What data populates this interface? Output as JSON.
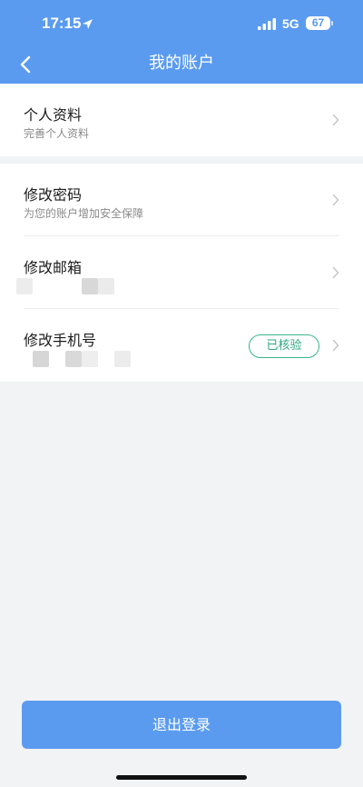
{
  "status_bar": {
    "time": "17:15",
    "network": "5G",
    "battery": "67"
  },
  "nav": {
    "title": "我的账户"
  },
  "profile_section": {
    "title": "个人资料",
    "subtitle": "完善个人资料"
  },
  "security_section": {
    "password": {
      "title": "修改密码",
      "subtitle": "为您的账户增加安全保障"
    },
    "email": {
      "title": "修改邮箱"
    },
    "phone": {
      "title": "修改手机号",
      "badge": "已核验"
    }
  },
  "logout": {
    "label": "退出登录"
  },
  "colors": {
    "primary": "#5a9bf0",
    "verified": "#2fa87e",
    "background": "#f2f3f5"
  },
  "icons": {
    "back": "chevron-left-icon",
    "row_arrow": "chevron-right-icon",
    "location": "location-arrow-icon",
    "signal": "signal-bars-icon"
  }
}
